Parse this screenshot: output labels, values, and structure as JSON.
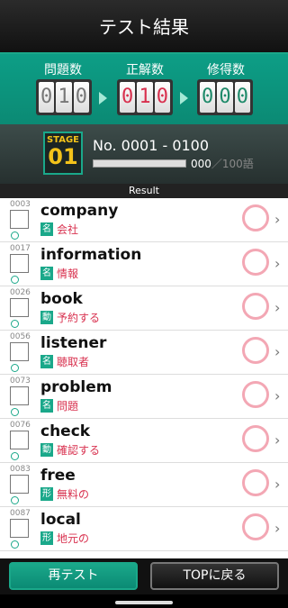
{
  "header": {
    "title": "テスト結果"
  },
  "score": {
    "questions": {
      "label": "問題数",
      "digits": [
        "0",
        "1",
        "0"
      ]
    },
    "correct": {
      "label": "正解数",
      "digits": [
        "0",
        "1",
        "0"
      ]
    },
    "mastered": {
      "label": "修得数",
      "digits": [
        "0",
        "0",
        "0"
      ]
    }
  },
  "stage": {
    "label": "STAGE",
    "number": "01",
    "range": "No. 0001 - 0100",
    "progress_count": "000",
    "progress_total": "／100語",
    "progress_fraction": 0.0
  },
  "result_label": "Result",
  "items": [
    {
      "num": "0003",
      "word": "company",
      "pos": "名",
      "meaning": "会社"
    },
    {
      "num": "0017",
      "word": "information",
      "pos": "名",
      "meaning": "情報"
    },
    {
      "num": "0026",
      "word": "book",
      "pos": "動",
      "meaning": "予約する"
    },
    {
      "num": "0056",
      "word": "listener",
      "pos": "名",
      "meaning": "聴取者"
    },
    {
      "num": "0073",
      "word": "problem",
      "pos": "名",
      "meaning": "問題"
    },
    {
      "num": "0076",
      "word": "check",
      "pos": "動",
      "meaning": "確認する"
    },
    {
      "num": "0083",
      "word": "free",
      "pos": "形",
      "meaning": "無料の"
    },
    {
      "num": "0087",
      "word": "local",
      "pos": "形",
      "meaning": "地元の"
    }
  ],
  "footer": {
    "retest_label": "再テスト",
    "top_label": "TOPに戻る"
  },
  "colors": {
    "accent": "#1aa88a",
    "wrong": "#d8304e",
    "stage": "#f2c21a"
  }
}
